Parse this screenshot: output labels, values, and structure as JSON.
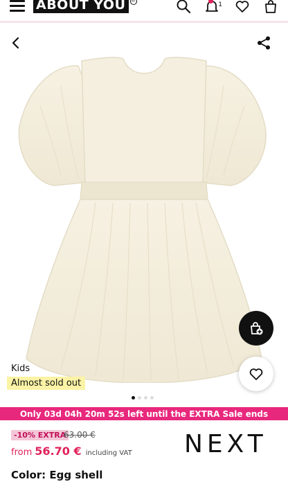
{
  "header": {
    "logo_text": "ABOUT YOU",
    "logo_reg": "®",
    "notification_count": "1",
    "icons": [
      "menu-icon",
      "search-icon",
      "bell-icon",
      "heart-icon",
      "bag-icon"
    ]
  },
  "product": {
    "category": "Kids",
    "badge": "Almost sold out",
    "image_count": 4,
    "active_image": 1
  },
  "sale_banner": "Only 03d 04h 20m 52s left until the EXTRA Sale ends",
  "pricing": {
    "extra_badge": "-10% EXTRA",
    "old_price": "63.00 €",
    "from_label": "from",
    "price": "56.70 €",
    "vat_note": "including VAT"
  },
  "brand": "NEXT",
  "color_line": "Color: Egg shell",
  "colors": {
    "accent_pink": "#e8287c",
    "price_red": "#e0215a",
    "badge_yellow": "#fbf3a5"
  }
}
